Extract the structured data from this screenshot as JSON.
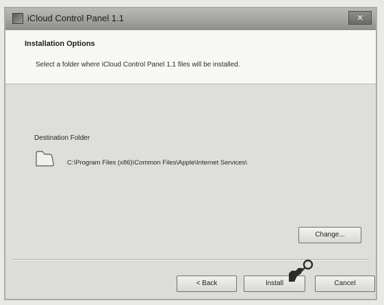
{
  "window": {
    "title": "iCloud Control Panel 1.1",
    "close_label": "✕"
  },
  "header": {
    "title": "Installation Options",
    "description": "Select a folder where iCloud Control Panel 1.1 files will be installed."
  },
  "destination": {
    "label": "Destination Folder",
    "path": "C:\\Program Files (x86)\\Common Files\\Apple\\Internet Services\\"
  },
  "buttons": {
    "change": "Change...",
    "back": "< Back",
    "install": "Install",
    "cancel": "Cancel"
  },
  "icons": {
    "window": "app-icon",
    "folder": "folder-icon",
    "cursor": "cursor-pointer-icon"
  }
}
